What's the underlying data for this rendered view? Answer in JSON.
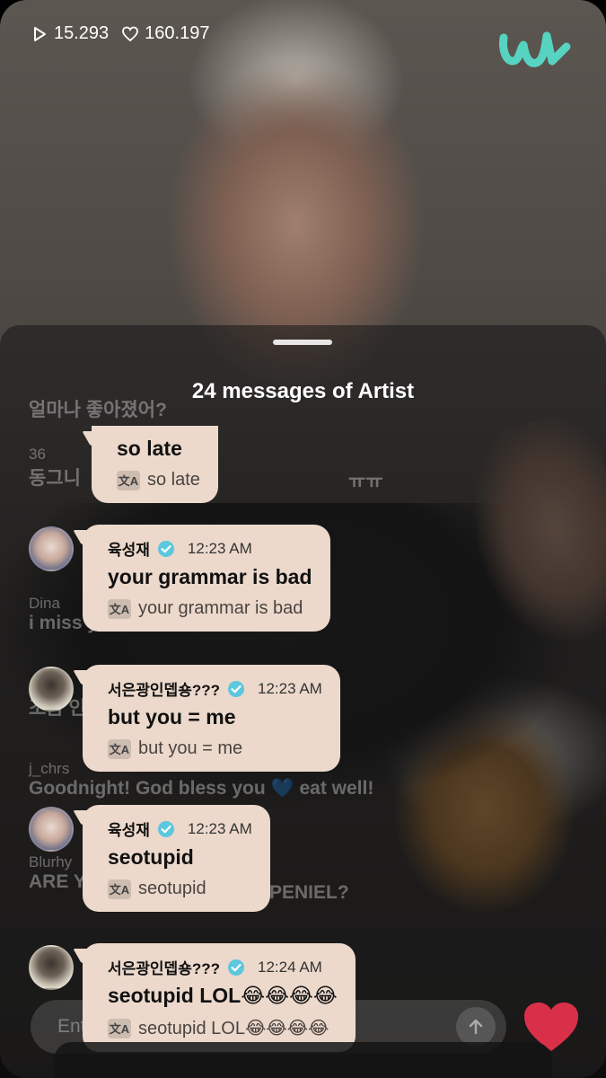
{
  "stats": {
    "plays": "15.293",
    "likes": "160.197"
  },
  "panel": {
    "title": "24 messages of Artist"
  },
  "background_chat": [
    {
      "name": "",
      "message": "얼마나 좋아졌어?"
    },
    {
      "name": "36",
      "message": "동그니"
    },
    {
      "name": "",
      "message": "ㅠㅠ"
    },
    {
      "name": "Dina",
      "message": "i miss y"
    },
    {
      "name": "",
      "message": "조금 인"
    },
    {
      "name": "j_chrs",
      "message": "Goodnight! God bless you 💙 eat well!"
    },
    {
      "name": "Blurhy",
      "message": "ARE Y"
    },
    {
      "name": "",
      "message": "PENIEL?"
    }
  ],
  "messages": [
    {
      "author": "",
      "time": "",
      "text": "so late",
      "translation": "so late",
      "avatar": ""
    },
    {
      "author": "육성재",
      "time": "12:23 AM",
      "text": "your grammar is bad",
      "translation": "your grammar is bad",
      "avatar": "yook"
    },
    {
      "author": "서은광인뎁숑???",
      "time": "12:23 AM",
      "text": "but you = me",
      "translation": "but you = me",
      "avatar": "seo"
    },
    {
      "author": "육성재",
      "time": "12:23 AM",
      "text": "seotupid",
      "translation": "seotupid",
      "avatar": "yook"
    },
    {
      "author": "서은광인뎁숑???",
      "time": "12:24 AM",
      "text": "seotupid LOL😂😂😂😂",
      "translation": "seotupid LOL😂😂😂😂",
      "avatar": "seo"
    }
  ],
  "translate_icon_label": "文A",
  "input": {
    "placeholder": "Ent"
  },
  "icons": [
    "play-icon",
    "heart-outline-icon",
    "weverse-logo",
    "verified-badge-icon",
    "translate-icon",
    "send-arrow-icon",
    "heart-icon"
  ],
  "colors": {
    "bubble": "#ecd9cc",
    "verified": "#5cc7dd",
    "logo": "#57d3c1",
    "heart": "#d9304a"
  }
}
